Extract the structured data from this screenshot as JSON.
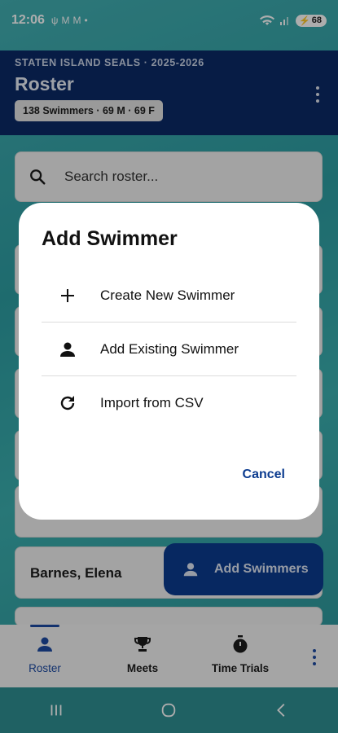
{
  "status_bar": {
    "time": "12:06",
    "notifications": [
      "ψ",
      "M",
      "M",
      "•"
    ],
    "battery": "68"
  },
  "header": {
    "team_season": "STATEN ISLAND SEALS · 2025-2026",
    "title": "Roster",
    "count_chip": "138 Swimmers · 69 M · 69 F"
  },
  "search": {
    "placeholder": "Search roster..."
  },
  "list": {
    "visible_name": "Barnes, Elena"
  },
  "fab": {
    "label": "Add Swimmers"
  },
  "bottom_nav": {
    "items": [
      {
        "label": "Roster",
        "icon": "person-icon",
        "active": true
      },
      {
        "label": "Meets",
        "icon": "trophy-icon",
        "active": false
      },
      {
        "label": "Time Trials",
        "icon": "stopwatch-icon",
        "active": false
      }
    ]
  },
  "dialog": {
    "title": "Add Swimmer",
    "options": [
      {
        "label": "Create New Swimmer",
        "icon": "plus-icon"
      },
      {
        "label": "Add Existing Swimmer",
        "icon": "person-icon"
      },
      {
        "label": "Import from CSV",
        "icon": "refresh-icon"
      }
    ],
    "cancel_label": "Cancel"
  },
  "colors": {
    "header_bg": "#0b2a66",
    "accent": "#0b3b8f",
    "nav_active": "#1d4ba3"
  }
}
